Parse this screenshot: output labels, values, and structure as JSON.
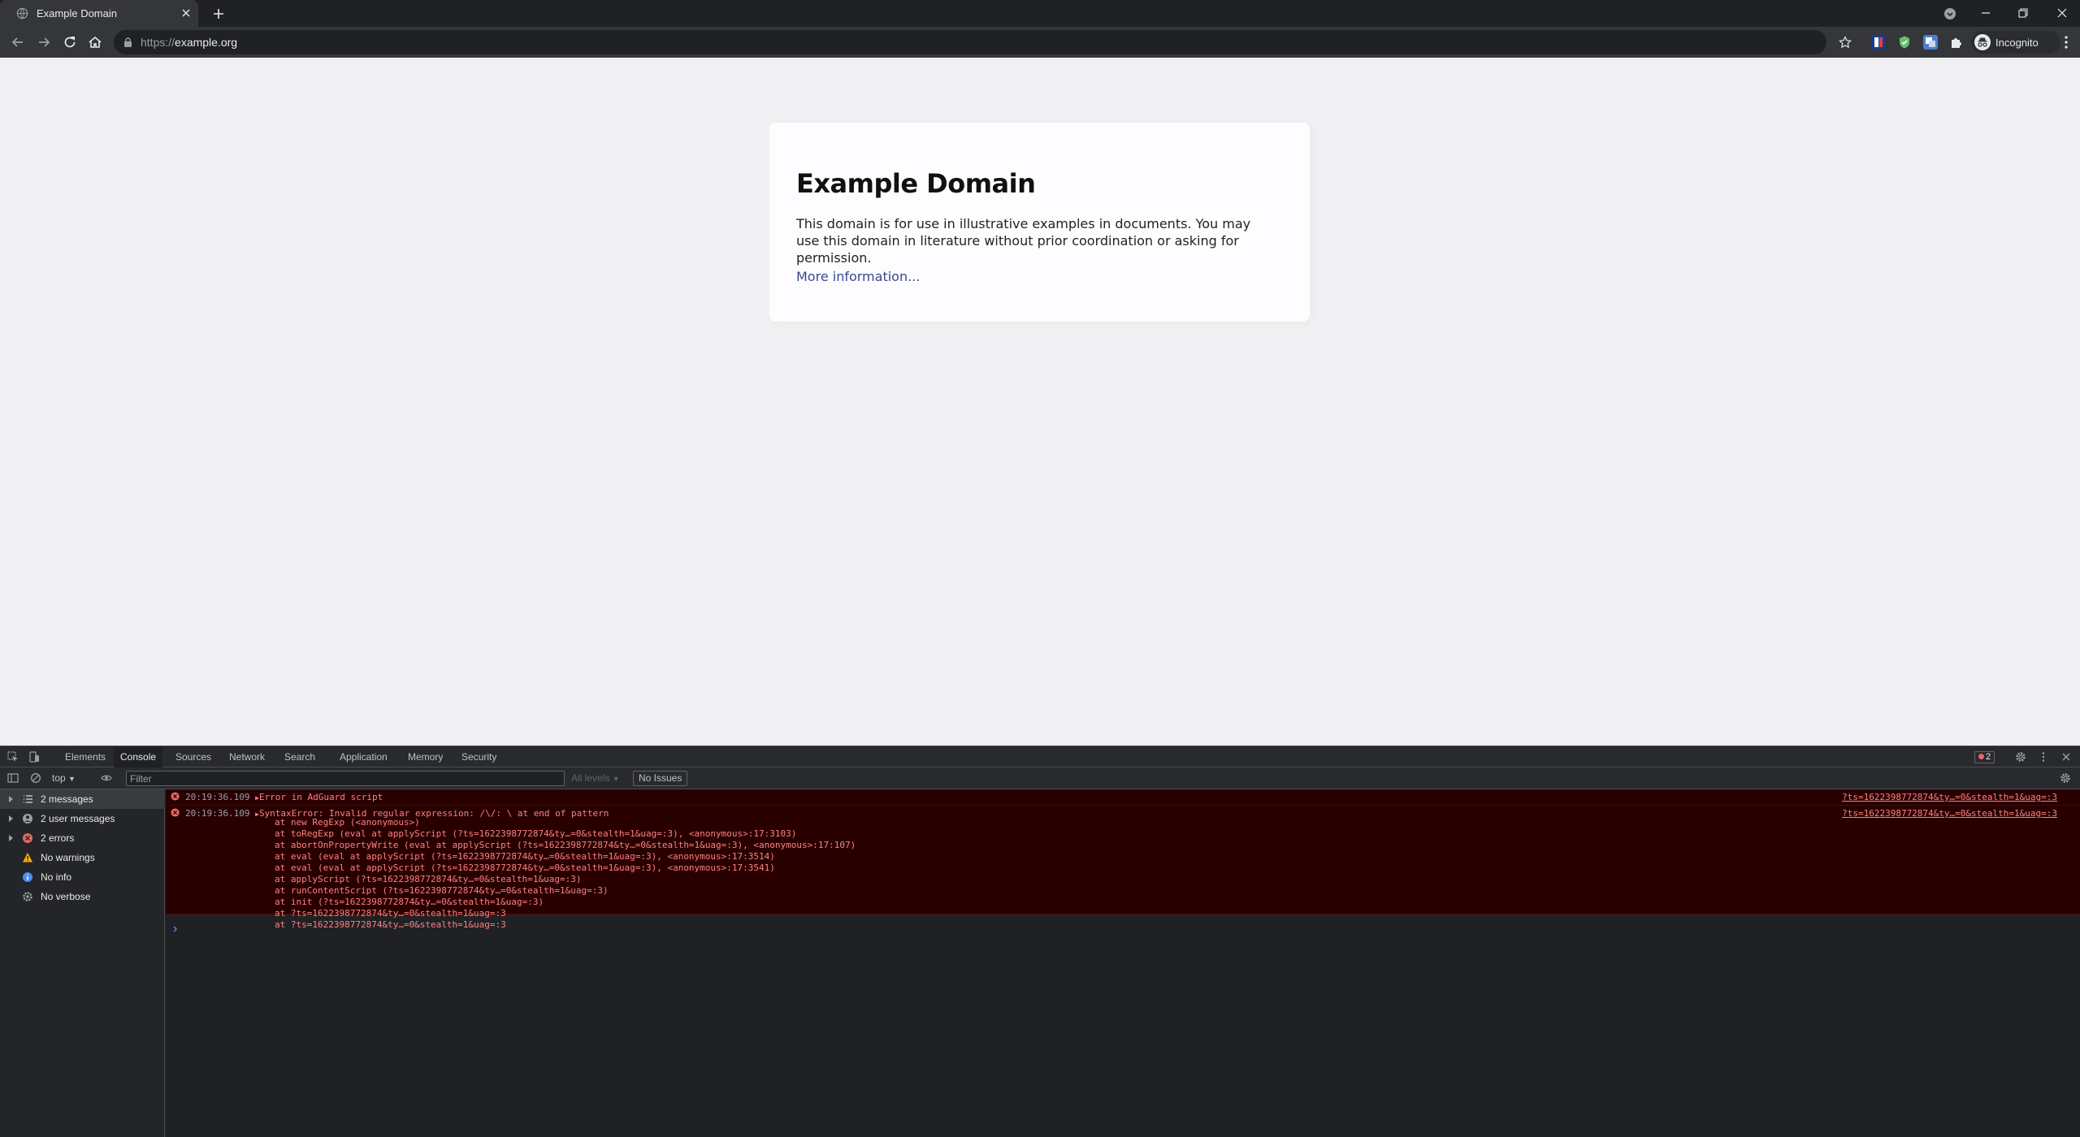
{
  "browser": {
    "tab_title": "Example Domain",
    "url_scheme": "https://",
    "url_host": "example.org",
    "profile_label": "Incognito"
  },
  "page": {
    "heading": "Example Domain",
    "paragraph": "This domain is for use in illustrative examples in documents. You may use this domain in literature without prior coordination or asking for permission.",
    "link": "More information..."
  },
  "devtools": {
    "tabs": [
      "Elements",
      "Console",
      "Sources",
      "Network",
      "Search",
      "Application",
      "Memory",
      "Security"
    ],
    "active_tab": "Console",
    "error_count": "2",
    "context": "top",
    "filter_placeholder": "Filter",
    "levels_label": "All levels",
    "issues_label": "No Issues",
    "sidebar": [
      {
        "label": "2 messages",
        "icon": "list-icon"
      },
      {
        "label": "2 user messages",
        "icon": "user-icon"
      },
      {
        "label": "2 errors",
        "icon": "error-icon"
      },
      {
        "label": "No warnings",
        "icon": "warning-icon"
      },
      {
        "label": "No info",
        "icon": "info-icon"
      },
      {
        "label": "No verbose",
        "icon": "verbose-icon"
      }
    ],
    "messages": [
      {
        "timestamp": "20:19:36.109",
        "text": "Error in AdGuard script",
        "source": "?ts=1622398772874&ty…=0&stealth=1&uag=:3"
      },
      {
        "timestamp": "20:19:36.109",
        "text": "SyntaxError: Invalid regular expression: /\\/: \\ at end of pattern",
        "source": "?ts=1622398772874&ty…=0&stealth=1&uag=:3",
        "stack": [
          "at new RegExp (<anonymous>)",
          "at toRegExp (eval at applyScript (?ts=1622398772874&ty…=0&stealth=1&uag=:3), <anonymous>:17:3103)",
          "at abortOnPropertyWrite (eval at applyScript (?ts=1622398772874&ty…=0&stealth=1&uag=:3), <anonymous>:17:107)",
          "at eval (eval at applyScript (?ts=1622398772874&ty…=0&stealth=1&uag=:3), <anonymous>:17:3514)",
          "at eval (eval at applyScript (?ts=1622398772874&ty…=0&stealth=1&uag=:3), <anonymous>:17:3541)",
          "at applyScript (?ts=1622398772874&ty…=0&stealth=1&uag=:3)",
          "at runContentScript (?ts=1622398772874&ty…=0&stealth=1&uag=:3)",
          "at init (?ts=1622398772874&ty…=0&stealth=1&uag=:3)",
          "at ?ts=1622398772874&ty…=0&stealth=1&uag=:3",
          "at ?ts=1622398772874&ty…=0&stealth=1&uag=:3"
        ]
      }
    ]
  },
  "colors": {
    "chrome_dark": "#202124",
    "toolbar": "#35363a",
    "error_text": "#ff8080",
    "error_bg": "#290000",
    "link": "#38488f"
  }
}
